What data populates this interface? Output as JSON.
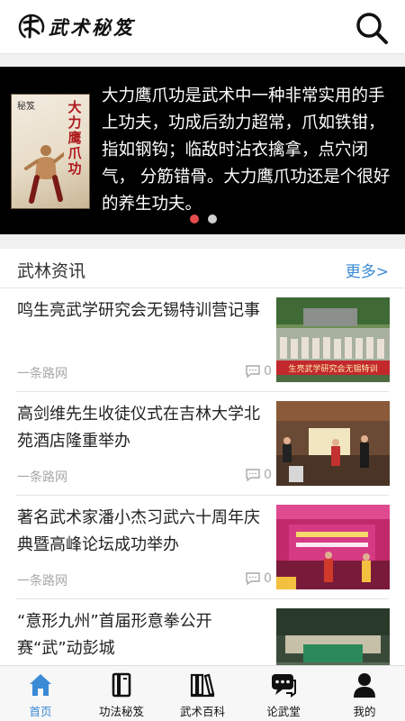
{
  "header": {
    "app_name": "武术秘笈",
    "logo_icon": "logo-icon",
    "search_icon": "search-icon"
  },
  "banner": {
    "book_title": "大力鹰爪功",
    "book_subtitle": "秘笈",
    "text": "大力鹰爪功是武术中一种非常实用的手上功夫，功成后劲力超常，爪如铁钳，指如钢钩；临敌时沾衣擒拿，点穴闭气， 分筋错骨。大力鹰爪功还是个很好的养生功夫。",
    "slide_count": 2,
    "active_slide": 1
  },
  "section": {
    "title": "武林资讯",
    "more": "更多>"
  },
  "news": [
    {
      "title": "鸣生亮武学研究会无锡特训营记事",
      "source": "一条路网",
      "comments": "0",
      "thumb_banner": "生亮武学研究会无锡特训"
    },
    {
      "title": "高剑维先生收徒仪式在吉林大学北苑酒店隆重举办",
      "source": "一条路网",
      "comments": "0"
    },
    {
      "title": "著名武术家潘小杰习武六十周年庆典暨高峰论坛成功举办",
      "source": "一条路网",
      "comments": "0"
    },
    {
      "title": "“意形九州”首届形意拳公开赛“武”动彭城",
      "source": "",
      "comments": ""
    }
  ],
  "tabbar": {
    "items": [
      {
        "label": "首页",
        "icon": "home-icon",
        "active": true
      },
      {
        "label": "功法秘笈",
        "icon": "book-icon",
        "active": false
      },
      {
        "label": "武术百科",
        "icon": "library-icon",
        "active": false
      },
      {
        "label": "论武堂",
        "icon": "chat-icon",
        "active": false
      },
      {
        "label": "我的",
        "icon": "user-icon",
        "active": false
      }
    ]
  },
  "colors": {
    "accent": "#3a8ad6",
    "dot_active": "#e74c4c",
    "banner_bg": "#000000",
    "divider": "#e6e6e6"
  }
}
